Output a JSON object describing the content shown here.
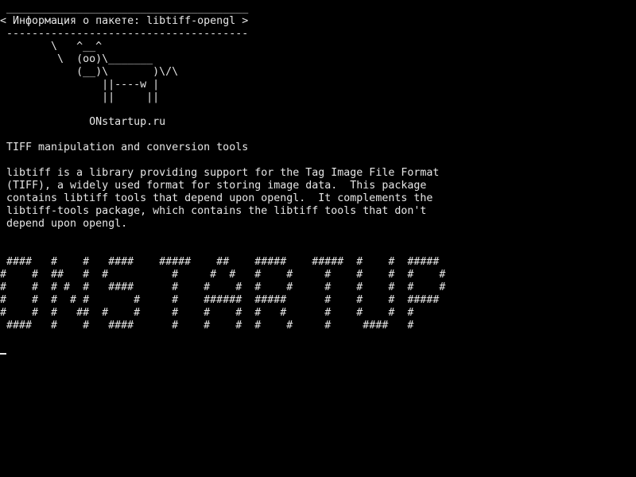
{
  "cowsay": {
    "text": " ______________________________________\n< Информация о пакете: libtiff-opengl >\n --------------------------------------\n        \\   ^__^\n         \\  (oo)\\_______\n            (__)\\       )\\/\\\n                ||----w |\n                ||     ||"
  },
  "site": {
    "text": "              ONstartup.ru"
  },
  "package": {
    "summary": "TIFF manipulation and conversion tools",
    "description": "libtiff is a library providing support for the Tag Image File Format\n(TIFF), a widely used format for storing image data.  This package\ncontains libtiff tools that depend upon opengl.  It complements the\nlibtiff-tools package, which contains the libtiff tools that don't\ndepend upon opengl."
  },
  "banner": {
    "text": " ####   #    #   ####    #####    ##    #####    #####  #    #  #####\n#    #  ##   #  #          #     #  #   #    #     #    #    #  #    #\n#    #  # #  #   ####      #    #    #  #    #     #    #    #  #    #\n#    #  #  # #       #     #    ######  #####      #    #    #  #####\n#    #  #   ##  #    #     #    #    #  #   #      #    #    #  #\n ####   #    #   ####      #    #    #  #    #     #     ####   #"
  },
  "colors": {
    "background": "#000000",
    "foreground": "#e6e6e6"
  }
}
